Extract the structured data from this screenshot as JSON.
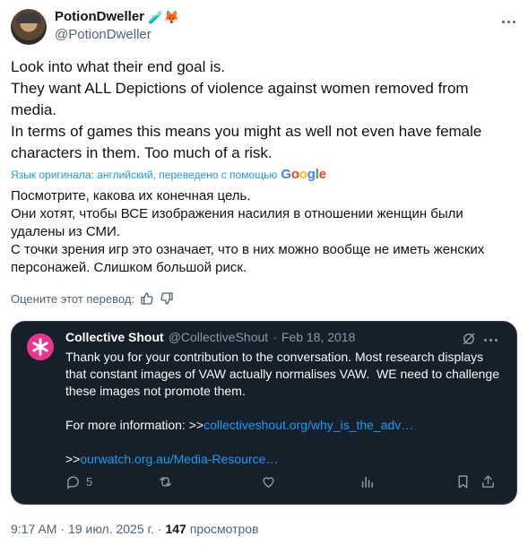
{
  "author": {
    "display_name": "PotionDweller",
    "name_emojis": "🧪🦊",
    "handle": "@PotionDweller",
    "more_icon": "more-horizontal-icon"
  },
  "tweet": {
    "lines": [
      "Look into what their end goal is.",
      "They want ALL Depictions of violence against women removed from media.",
      "In terms of games this means you might as well not even have female characters in them. Too much of a risk."
    ]
  },
  "translation_notice": {
    "text": "Язык оригинала: английский, переведено с помощью",
    "google": [
      "G",
      "o",
      "o",
      "g",
      "l",
      "e"
    ]
  },
  "translation": {
    "lines": [
      "Посмотрите, какова их конечная цель.",
      "Они хотят, чтобы ВСЕ изображения насилия в отношении женщин были удалены из СМИ.",
      "С точки зрения игр это означает, что в них можно вообще не иметь женских персонажей. Слишком большой риск."
    ]
  },
  "rate": {
    "label": "Оцените этот перевод:",
    "thumb_up_icon": "thumbs-up-icon",
    "thumb_down_icon": "thumbs-down-icon"
  },
  "quote": {
    "display_name": "Collective Shout",
    "handle": "@CollectiveShout",
    "separator": "·",
    "date": "Feb 18, 2018",
    "body_line1": "Thank you for your contribution to the conversation. Most research displays that constant images of VAW actually normalises VAW.  WE need to challenge these images not promote them.",
    "more_info_prefix": "For more information: >>",
    "link1": "collectiveshout.org/why_is_the_adv…",
    "link2_prefix": ">>",
    "link2": "ourwatch.org.au/Media-Resource…",
    "reply_count": "5",
    "colors": {
      "background": "#15202b",
      "link": "#1d9bf0",
      "avatar": "#e8368f"
    }
  },
  "meta": {
    "time": "9:17 AM",
    "separator": "·",
    "date": "19 июл. 2025 г.",
    "separator2": "·",
    "views_count": "147",
    "views_label": "просмотров"
  }
}
